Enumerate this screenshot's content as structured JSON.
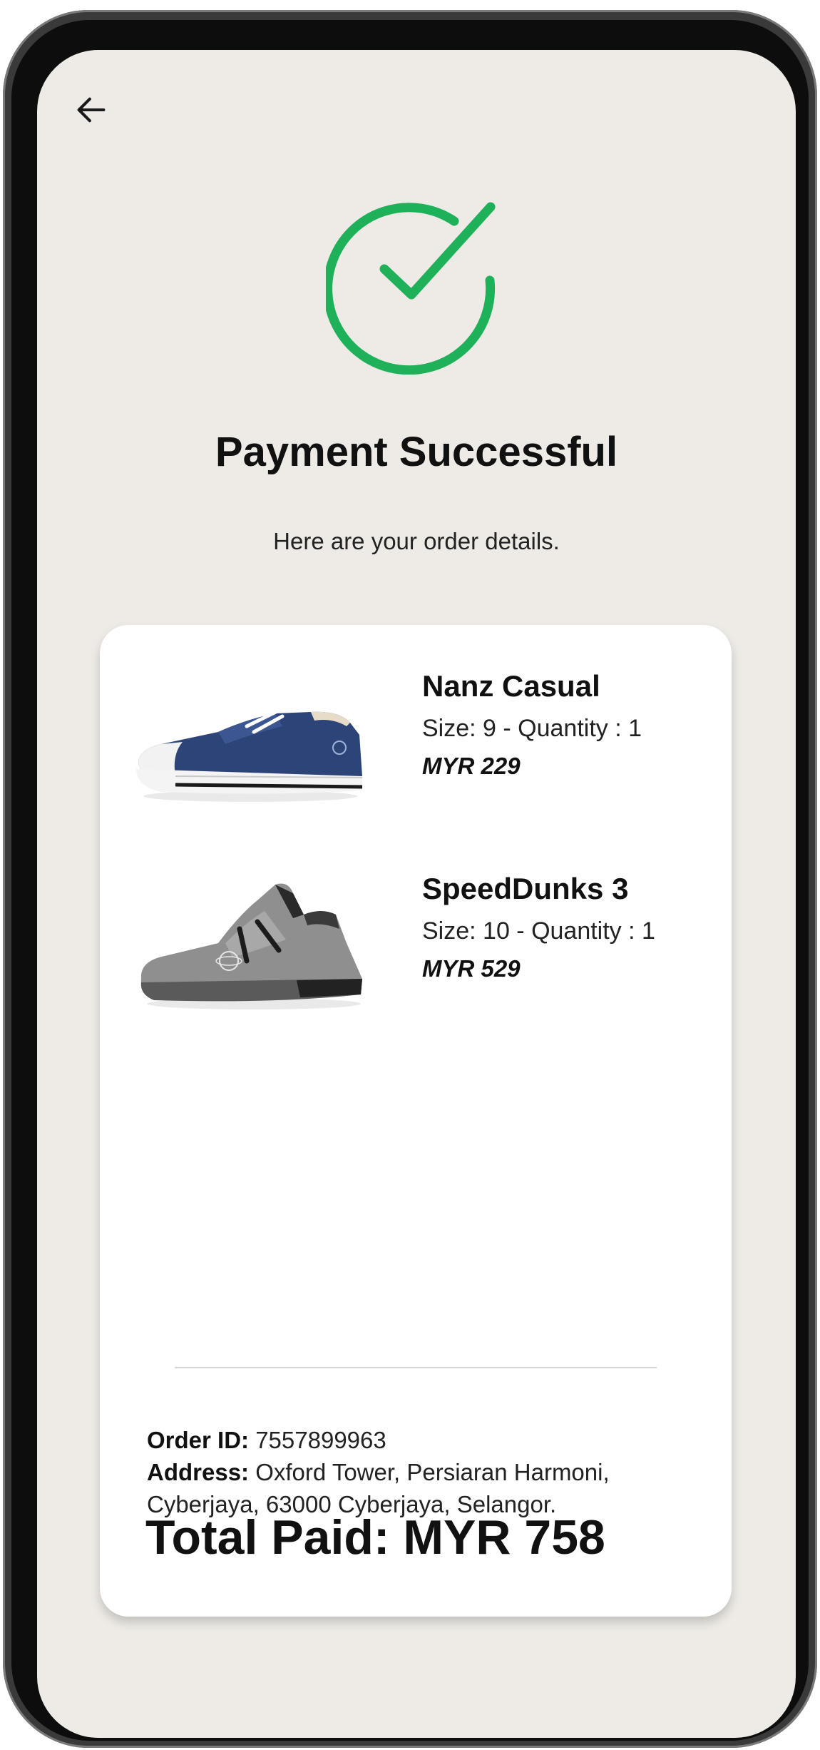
{
  "nav": {
    "back_icon": "arrow-left-icon"
  },
  "status": {
    "icon": "check-circle-icon",
    "accent_color": "#1fb15a",
    "title": "Payment Successful",
    "subtitle": "Here are your order details."
  },
  "order": {
    "items": [
      {
        "name": "Nanz Casual",
        "meta": "Size: 9 - Quantity : 1",
        "price": "MYR 229",
        "image": "blue-canvas-sneaker-image"
      },
      {
        "name": "SpeedDunks 3",
        "meta": "Size: 10 - Quantity : 1",
        "price": "MYR 529",
        "image": "grey-knit-sneaker-image"
      }
    ],
    "order_id_label": "Order ID:",
    "order_id": "7557899963",
    "address_label": "Address:",
    "address": "Oxford Tower, Persiaran Harmoni, Cyberjaya, 63000 Cyberjaya, Selangor.",
    "total": "Total Paid: MYR 758"
  }
}
